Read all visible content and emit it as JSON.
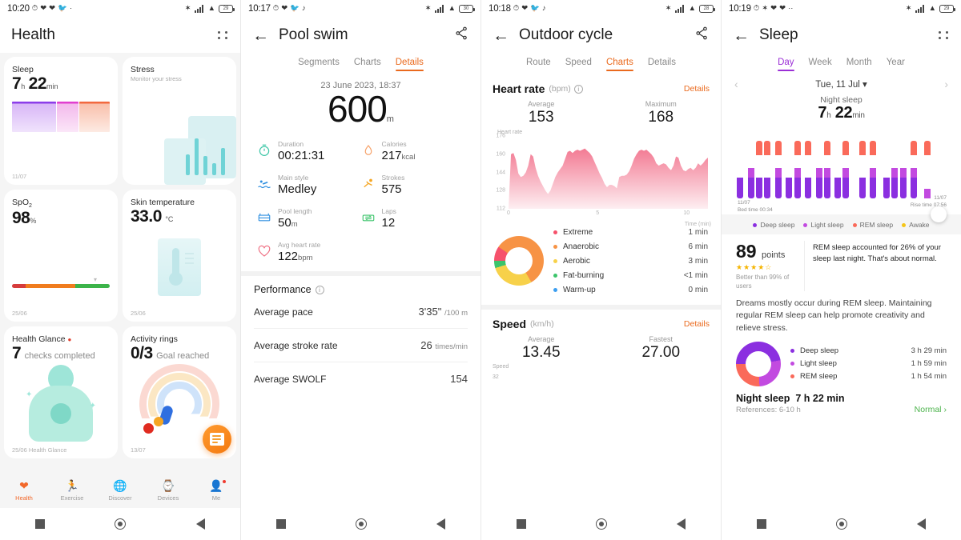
{
  "panels": {
    "health": {
      "status": {
        "time": "10:20",
        "battery": "29"
      },
      "title": "Health",
      "cards": [
        {
          "title": "Sleep",
          "value": "7",
          "unit1": "h",
          "value2": "22",
          "unit2": "min",
          "date": "11/07"
        },
        {
          "title": "Stress",
          "subtitle": "Monitor your stress"
        },
        {
          "title": "SpO",
          "title_sub": "2",
          "value": "98",
          "unit1": "%",
          "date": "25/06"
        },
        {
          "title": "Skin temperature",
          "value": "33.0",
          "unit1": "°C",
          "date": "25/06"
        },
        {
          "title": "Health Glance",
          "value": "7",
          "unit1": "checks completed",
          "date": "25/06 Health Glance"
        },
        {
          "title": "Activity rings",
          "value": "0/3",
          "unit1": "Goal reached",
          "date": "13/07"
        }
      ],
      "tabs": [
        {
          "label": "Health",
          "icon": "heart-icon",
          "active": true
        },
        {
          "label": "Exercise",
          "icon": "runner-icon",
          "active": false
        },
        {
          "label": "Discover",
          "icon": "globe-icon",
          "active": false
        },
        {
          "label": "Devices",
          "icon": "watch-icon",
          "active": false
        },
        {
          "label": "Me",
          "icon": "profile-icon",
          "active": false,
          "badge": true
        }
      ]
    },
    "swim": {
      "status": {
        "time": "10:17",
        "battery": "30"
      },
      "title": "Pool swim",
      "tabs": [
        {
          "label": "Segments",
          "active": false
        },
        {
          "label": "Charts",
          "active": false
        },
        {
          "label": "Details",
          "active": true
        }
      ],
      "date": "23 June 2023, 18:37",
      "distance": "600",
      "distance_unit": "m",
      "metrics": [
        {
          "label": "Duration",
          "value": "00:21:31",
          "unit": "",
          "icon": "stopwatch-icon"
        },
        {
          "label": "Calories",
          "value": "217",
          "unit": "kcal",
          "icon": "flame-icon"
        },
        {
          "label": "Main style",
          "value": "Medley",
          "unit": "",
          "icon": "swimmer-icon"
        },
        {
          "label": "Strokes",
          "value": "575",
          "unit": "",
          "icon": "strokes-icon"
        },
        {
          "label": "Pool length",
          "value": "50",
          "unit": "m",
          "icon": "pool-icon"
        },
        {
          "label": "Laps",
          "value": "12",
          "unit": "",
          "icon": "laps-icon"
        },
        {
          "label": "Avg heart rate",
          "value": "122",
          "unit": "bpm",
          "icon": "heart-outline-icon"
        }
      ],
      "performance_title": "Performance",
      "performance": [
        {
          "label": "Average pace",
          "value": "3'35\"",
          "unit": "/100 m"
        },
        {
          "label": "Average stroke rate",
          "value": "26",
          "unit": "times/min"
        },
        {
          "label": "Average SWOLF",
          "value": "154",
          "unit": ""
        }
      ]
    },
    "cycle": {
      "status": {
        "time": "10:18",
        "battery": "28"
      },
      "title": "Outdoor cycle",
      "tabs": [
        {
          "label": "Route",
          "active": false
        },
        {
          "label": "Speed",
          "active": false
        },
        {
          "label": "Charts",
          "active": true
        },
        {
          "label": "Details",
          "active": false
        }
      ],
      "heart_rate": {
        "title": "Heart rate",
        "unit": "(bpm)",
        "details_label": "Details",
        "average_label": "Average",
        "average": "153",
        "maximum_label": "Maximum",
        "maximum": "168"
      },
      "zones": [
        {
          "label": "Extreme",
          "value": "1 min",
          "color": "#f6516b"
        },
        {
          "label": "Anaerobic",
          "value": "6 min",
          "color": "#f79345"
        },
        {
          "label": "Aerobic",
          "value": "3 min",
          "color": "#f7d14a"
        },
        {
          "label": "Fat-burning",
          "value": "<1 min",
          "color": "#3cc46b"
        },
        {
          "label": "Warm-up",
          "value": "0 min",
          "color": "#3c9ef0"
        }
      ],
      "speed": {
        "title": "Speed",
        "unit": "(km/h)",
        "details_label": "Details",
        "average_label": "Average",
        "average": "13.45",
        "fastest_label": "Fastest",
        "fastest": "27.00",
        "chart_label": "Speed",
        "chart_first_tick": "32"
      }
    },
    "sleep": {
      "status": {
        "time": "10:19",
        "battery": "29"
      },
      "title": "Sleep",
      "tabs": [
        {
          "label": "Day",
          "active": true
        },
        {
          "label": "Week",
          "active": false
        },
        {
          "label": "Month",
          "active": false
        },
        {
          "label": "Year",
          "active": false
        }
      ],
      "date": "Tue, 11 Jul",
      "night_label": "Night sleep",
      "night_hours": "7",
      "night_h_unit": "h",
      "night_mins": "22",
      "night_m_unit": "min",
      "bed_date": "11/07",
      "bed_time": "Bed time 00:34",
      "rise_date": "11/07",
      "rise_time": "Rise time 07:56",
      "legend": [
        {
          "label": "Deep sleep",
          "color": "#8b2fe0"
        },
        {
          "label": "Light sleep",
          "color": "#c24ae0"
        },
        {
          "label": "REM sleep",
          "color": "#fa6a5a"
        },
        {
          "label": "Awake",
          "color": "#f5c518"
        }
      ],
      "score": "89",
      "score_unit": "points",
      "stars": "★★★★",
      "half_star": "☆",
      "score_sub": "Better than 99% of users",
      "score_note": "REM sleep accounted for 26% of your sleep last night. That's about normal.",
      "score_body": "Dreams mostly occur during REM sleep. Maintaining regular REM sleep can help promote creativity and relieve stress.",
      "breakdown": [
        {
          "label": "Deep sleep",
          "value": "3 h 29 min",
          "color": "#8b2fe0"
        },
        {
          "label": "Light sleep",
          "value": "1 h 59 min",
          "color": "#c24ae0"
        },
        {
          "label": "REM sleep",
          "value": "1 h 54 min",
          "color": "#fa6a5a"
        }
      ],
      "total_label": "Night sleep",
      "total_value": "7 h 22 min",
      "references": "References: 6-10 h",
      "status_label": "Normal"
    }
  },
  "chart_data": [
    {
      "type": "area",
      "title": "Heart rate",
      "ylabel": "Heart rate",
      "xlabel": "Time (min)",
      "ylim": [
        112,
        176
      ],
      "yticks": [
        112,
        128,
        144,
        160,
        176
      ],
      "xlim": [
        0,
        11.2
      ],
      "xticks": [
        0,
        5,
        10
      ],
      "grid": false,
      "color": "#f2738d",
      "values": [
        112,
        160,
        161,
        155,
        143,
        140,
        141,
        144,
        150,
        160,
        158,
        148,
        141,
        136,
        132,
        128,
        125,
        128,
        134,
        140,
        144,
        147,
        150,
        156,
        162,
        163,
        161,
        163,
        164,
        163,
        164,
        165,
        163,
        161,
        158,
        153,
        148,
        143,
        139,
        134,
        131,
        133,
        133,
        132,
        130,
        140,
        141,
        141,
        142,
        145,
        150,
        156,
        160,
        163,
        164,
        163,
        164,
        162,
        160,
        157,
        152,
        150,
        151,
        152,
        151,
        148,
        146,
        150,
        158,
        157,
        150,
        146,
        145,
        147,
        148,
        146,
        148,
        152,
        150,
        152,
        155,
        157
      ]
    },
    {
      "type": "pie",
      "title": "Heart rate zones",
      "labels": [
        "Extreme",
        "Anaerobic",
        "Aerobic",
        "Fat-burning",
        "Warm-up"
      ],
      "values": [
        1,
        6,
        3,
        0.5,
        0
      ],
      "value_labels": [
        "1 min",
        "6 min",
        "3 min",
        "<1 min",
        "0 min"
      ],
      "colors": [
        "#f6516b",
        "#f79345",
        "#f7d14a",
        "#3cc46b",
        "#3c9ef0"
      ],
      "legend": "right"
    },
    {
      "type": "bar",
      "title": "Sleep stages hypnogram",
      "xlabel": "",
      "ylabel": "",
      "categories": [
        "Deep sleep",
        "Light sleep",
        "REM sleep",
        "Awake"
      ],
      "colors": [
        "#8b2fe0",
        "#c24ae0",
        "#fa6a5a",
        "#f5c518"
      ],
      "bars": [
        {
          "x": 2,
          "deep": 42,
          "light": 0,
          "rem": 0
        },
        {
          "x": 10,
          "deep": 42,
          "light": 40,
          "rem": 0
        },
        {
          "x": 16,
          "deep": 42,
          "light": 0,
          "rem": 46
        },
        {
          "x": 22,
          "deep": 42,
          "light": 0,
          "rem": 46
        },
        {
          "x": 30,
          "deep": 42,
          "light": 22,
          "rem": 46
        },
        {
          "x": 38,
          "deep": 42,
          "light": 0,
          "rem": 0
        },
        {
          "x": 44,
          "deep": 42,
          "light": 30,
          "rem": 46
        },
        {
          "x": 52,
          "deep": 42,
          "light": 0,
          "rem": 46
        },
        {
          "x": 60,
          "deep": 42,
          "light": 28,
          "rem": 0
        },
        {
          "x": 66,
          "deep": 42,
          "light": 22,
          "rem": 46
        },
        {
          "x": 74,
          "deep": 42,
          "light": 0,
          "rem": 0
        },
        {
          "x": 80,
          "deep": 50,
          "light": 26,
          "rem": 46
        },
        {
          "x": 92,
          "deep": 42,
          "light": 0,
          "rem": 56
        },
        {
          "x": 100,
          "deep": 42,
          "light": 26,
          "rem": 46
        },
        {
          "x": 110,
          "deep": 42,
          "light": 0,
          "rem": 0
        },
        {
          "x": 116,
          "deep": 42,
          "light": 24,
          "rem": 0
        },
        {
          "x": 122,
          "deep": 42,
          "light": 26,
          "rem": 0
        },
        {
          "x": 130,
          "deep": 42,
          "light": 30,
          "rem": 46
        },
        {
          "x": 140,
          "deep": 0,
          "light": 32,
          "rem": 46
        }
      ]
    },
    {
      "type": "pie",
      "title": "Sleep composition",
      "labels": [
        "Deep sleep",
        "Light sleep",
        "REM sleep"
      ],
      "values": [
        3.483,
        1.983,
        1.9
      ],
      "value_labels": [
        "3 h 29 min",
        "1 h 59 min",
        "1 h 54 min"
      ],
      "colors": [
        "#8b2fe0",
        "#c24ae0",
        "#fa6a5a"
      ],
      "legend": "right"
    }
  ]
}
